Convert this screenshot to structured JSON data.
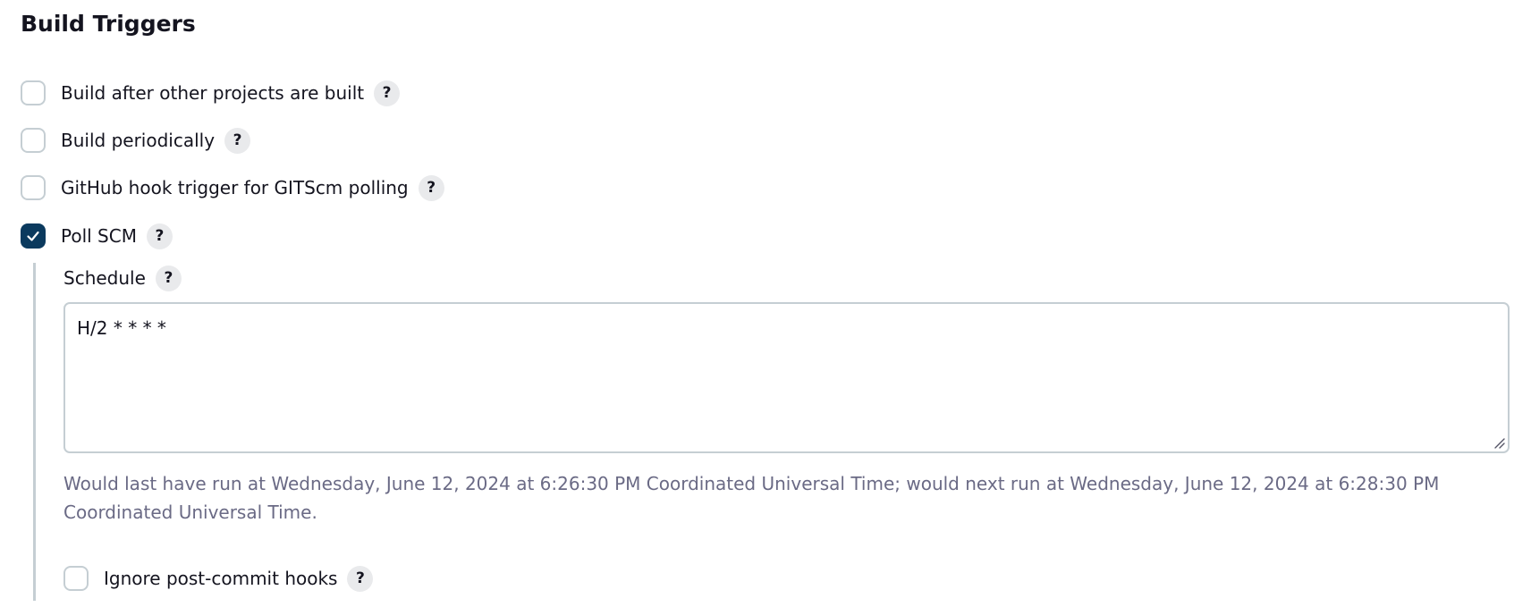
{
  "section": {
    "title": "Build Triggers"
  },
  "triggers": [
    {
      "label": "Build after other projects are built",
      "checked": false
    },
    {
      "label": "Build periodically",
      "checked": false
    },
    {
      "label": "GitHub hook trigger for GITScm polling",
      "checked": false
    },
    {
      "label": "Poll SCM",
      "checked": true
    }
  ],
  "help": {
    "glyph": "?"
  },
  "poll_scm": {
    "schedule_label": "Schedule",
    "schedule_value": "H/2 * * * *",
    "hint": "Would last have run at Wednesday, June 12, 2024 at 6:26:30 PM Coordinated Universal Time; would next run at Wednesday, June 12, 2024 at 6:28:30 PM Coordinated Universal Time.",
    "ignore_hooks_label": "Ignore post-commit hooks",
    "ignore_hooks_checked": false
  },
  "colors": {
    "checked_fill": "#0b3a5e",
    "checkbox_border": "#c5ced3",
    "hint_text": "#6a6a85",
    "help_bg": "#e9eaec"
  }
}
